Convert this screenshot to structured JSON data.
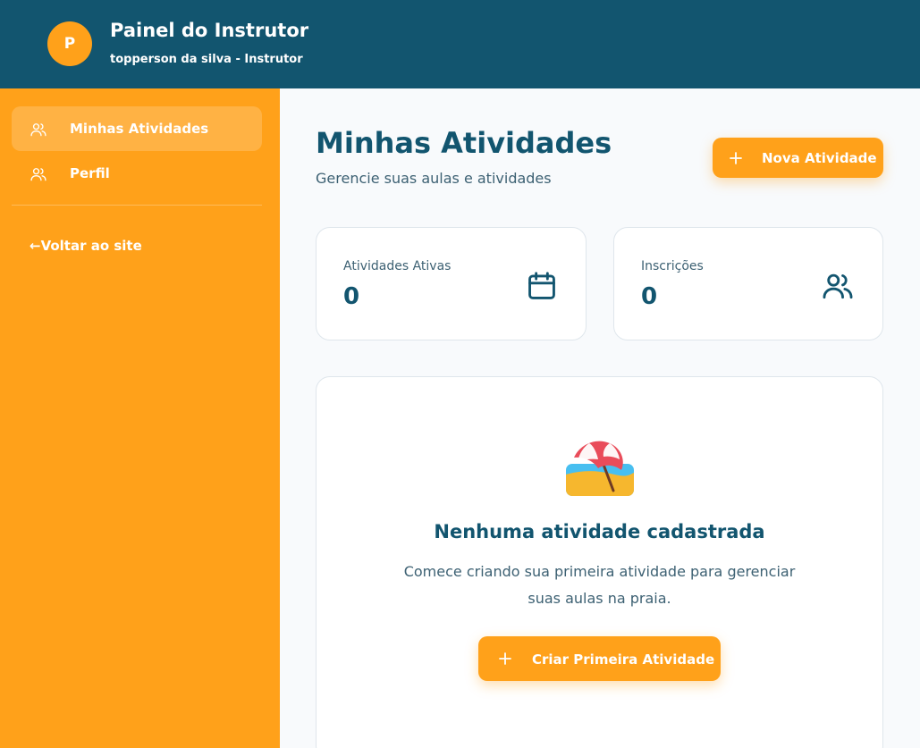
{
  "header": {
    "avatar_letter": "P",
    "title": "Painel do Instrutor",
    "subtitle": "topperson da silva - Instrutor"
  },
  "sidebar": {
    "items": [
      {
        "label": "Minhas Atividades",
        "icon": "users-icon",
        "active": true
      },
      {
        "label": "Perfil",
        "icon": "users-icon",
        "active": false
      }
    ],
    "back_link": "←Voltar ao site"
  },
  "main": {
    "title": "Minhas Atividades",
    "subtitle": "Gerencie suas aulas e atividades",
    "new_activity_button": "Nova Atividade",
    "stats": [
      {
        "label": "Atividades Ativas",
        "value": "0",
        "icon": "calendar-icon"
      },
      {
        "label": "Inscrições",
        "value": "0",
        "icon": "users-icon"
      }
    ],
    "empty_state": {
      "icon": "beach-umbrella-icon",
      "title": "Nenhuma atividade cadastrada",
      "text_line_1": "Comece criando sua primeira atividade para gerenciar",
      "text_line_2": "suas aulas na praia.",
      "button": "Criar Primeira Atividade"
    }
  },
  "colors": {
    "header": "#12556f",
    "sidebar": "#ffa11a",
    "accent": "#ffa11a",
    "text_dark": "#12556f"
  }
}
